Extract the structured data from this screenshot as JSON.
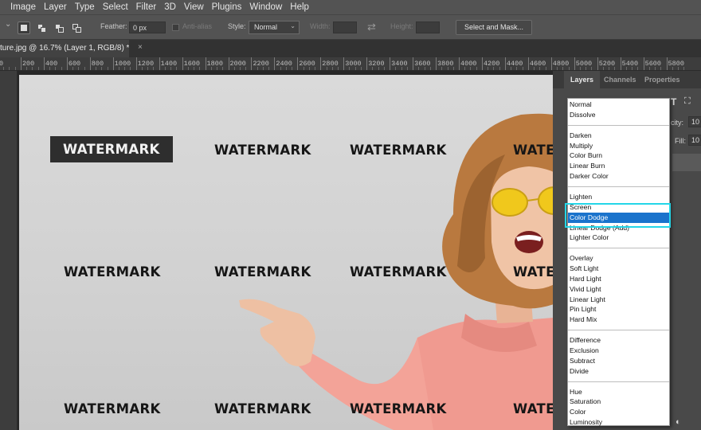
{
  "menu": [
    "Image",
    "Layer",
    "Type",
    "Select",
    "Filter",
    "3D",
    "View",
    "Plugins",
    "Window",
    "Help"
  ],
  "options": {
    "feather_label": "Feather:",
    "feather_value": "0 px",
    "antialias_label": "Anti-alias",
    "style_label": "Style:",
    "style_value": "Normal",
    "width_label": "Width:",
    "height_label": "Height:",
    "select_mask": "Select and Mask..."
  },
  "document": {
    "tab_title": "ture.jpg @ 16.7% (Layer 1, RGB/8) *",
    "close": "×"
  },
  "ruler": [
    "0",
    "200",
    "400",
    "600",
    "800",
    "1000",
    "1200",
    "1400",
    "1600",
    "1800",
    "2000",
    "2200",
    "2400",
    "2600",
    "2800",
    "3000",
    "3200",
    "3400",
    "3600",
    "3800",
    "4000",
    "4200",
    "4400",
    "4600",
    "4800",
    "5000",
    "5200",
    "5400",
    "5600",
    "5800"
  ],
  "canvas": {
    "watermark": "WATERMARK"
  },
  "panel": {
    "tabs": [
      "Layers",
      "Channels",
      "Properties"
    ],
    "opacity_label": "city:",
    "opacity_value": "10",
    "fill_label": "Fill:",
    "fill_value": "10"
  },
  "blend_modes": {
    "groups": [
      [
        "Normal",
        "Dissolve"
      ],
      [
        "Darken",
        "Multiply",
        "Color Burn",
        "Linear Burn",
        "Darker Color"
      ],
      [
        "Lighten",
        "Screen",
        "Color Dodge",
        "Linear Dodge (Add)",
        "Lighter Color"
      ],
      [
        "Overlay",
        "Soft Light",
        "Hard Light",
        "Vivid Light",
        "Linear Light",
        "Pin Light",
        "Hard Mix"
      ],
      [
        "Difference",
        "Exclusion",
        "Subtract",
        "Divide"
      ],
      [
        "Hue",
        "Saturation",
        "Color",
        "Luminosity"
      ]
    ],
    "selected": "Color Dodge"
  },
  "colors": {
    "accent_highlight": "#1a73cc",
    "callout": "#24d6e8",
    "app_bg": "#282828",
    "menu_bg": "#535353"
  }
}
